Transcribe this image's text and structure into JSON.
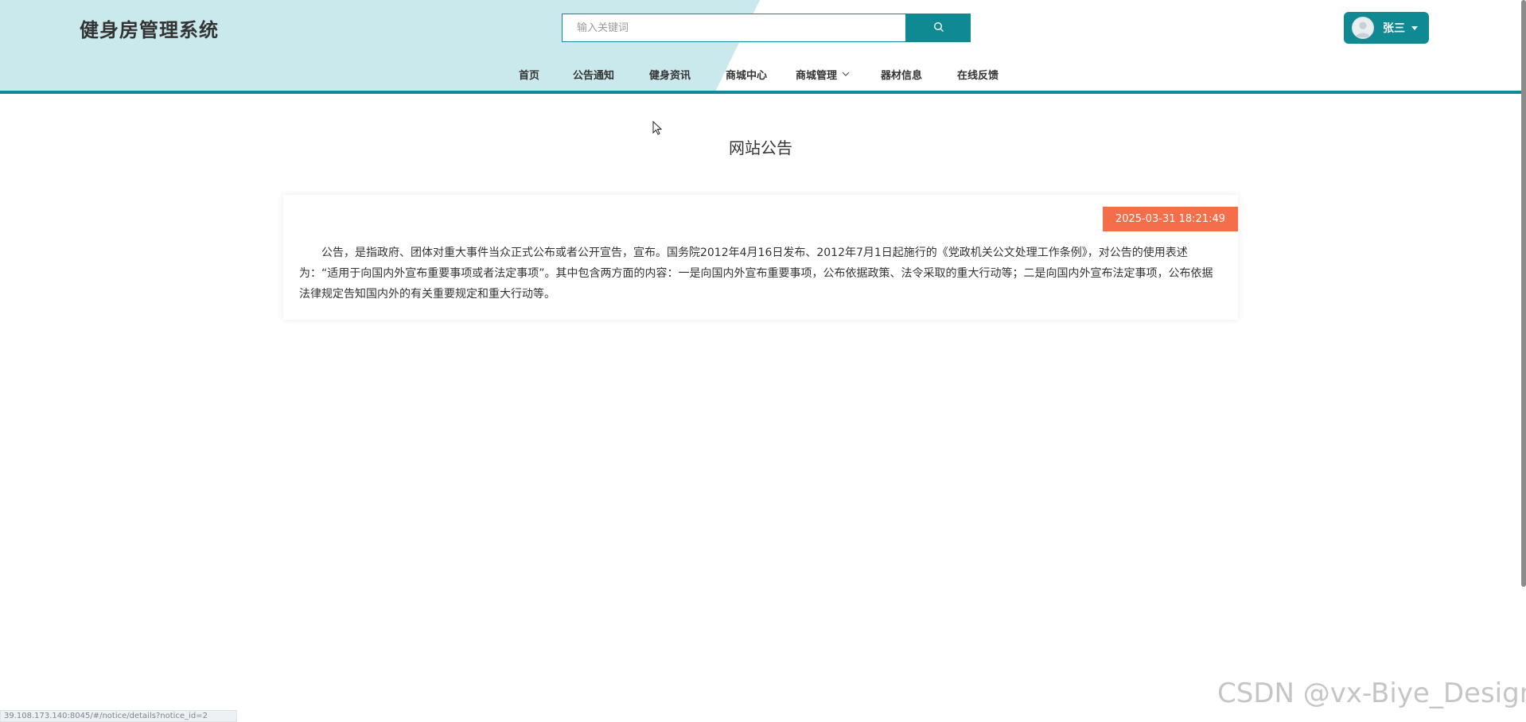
{
  "app": {
    "logo": "健身房管理系统"
  },
  "search": {
    "placeholder": "输入关键词"
  },
  "user": {
    "name": "张三"
  },
  "nav": {
    "items": [
      {
        "label": "首页"
      },
      {
        "label": "公告通知"
      },
      {
        "label": "健身资讯"
      },
      {
        "label": "商城中心"
      },
      {
        "label": "商城管理",
        "has_dropdown": true
      },
      {
        "label": "器材信息"
      },
      {
        "label": "在线反馈"
      }
    ]
  },
  "main": {
    "title": "网站公告",
    "notice": {
      "date": "2025-03-31 18:21:49",
      "content": "公告，是指政府、团体对重大事件当众正式公布或者公开宣告，宣布。国务院2012年4月16日发布、2012年7月1日起施行的《党政机关公文处理工作条例》，对公告的使用表述为：“适用于向国内外宣布重要事项或者法定事项”。其中包含两方面的内容：一是向国内外宣布重要事项，公布依据政策、法令采取的重大行动等；二是向国内外宣布法定事项，公布依据法律规定告知国内外的有关重要规定和重大行动等。"
    }
  },
  "status_bar": {
    "url": "39.108.173.140:8045/#/notice/details?notice_id=2"
  },
  "watermark": "CSDN @vx-Biye_Design",
  "colors": {
    "primary": "#0f8a93",
    "header_bg": "#c9e9ec",
    "date_badge": "#f56e4a"
  }
}
